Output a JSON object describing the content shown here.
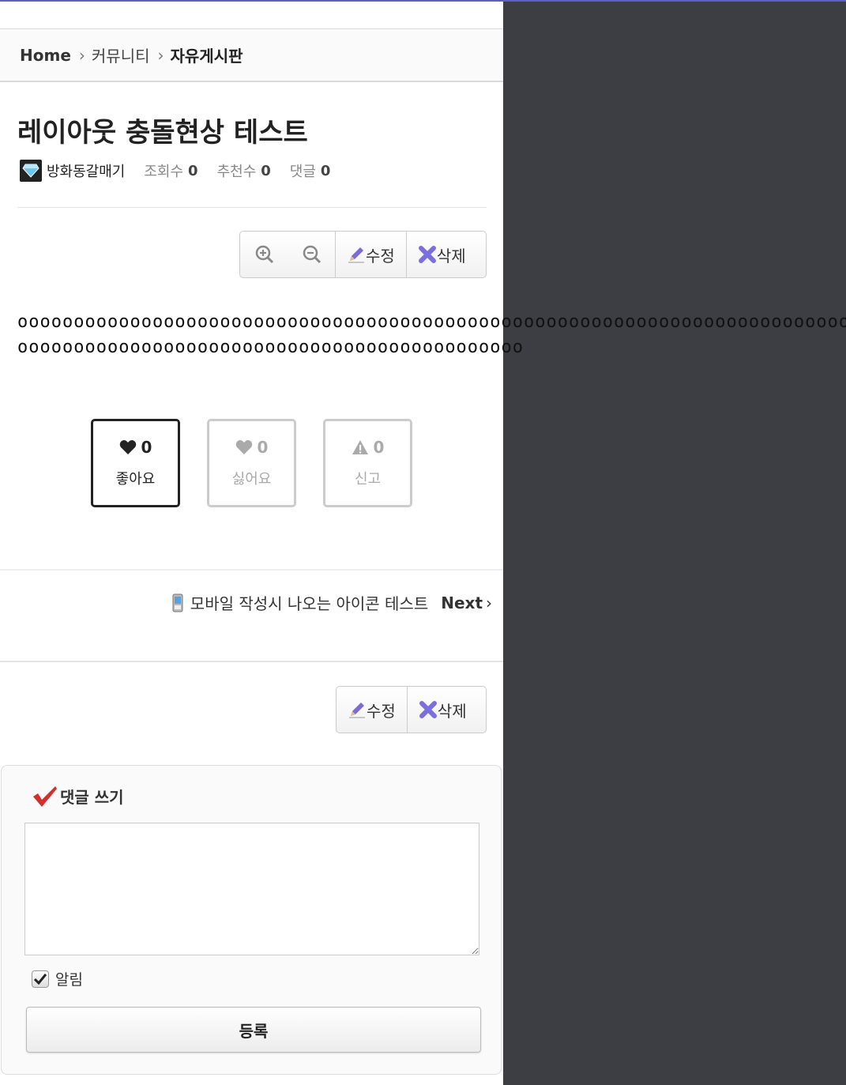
{
  "breadcrumb": {
    "home": "Home",
    "level1": "커뮤니티",
    "level2": "자유게시판"
  },
  "post": {
    "title": "레이아웃 충돌현상 테스트",
    "author": "방화동갈매기",
    "views_label": "조회수",
    "views": "0",
    "recommend_label": "추천수",
    "recommend": "0",
    "comments_label": "댓글",
    "comments": "0",
    "body_line1": "ooooooooooooooooooooooooooooooooooooooooooooooooooooooooooooooooooooooooooooooooooooooo",
    "body_line2": "ooooooooooooooooooooooooooooooooooooooooooooo"
  },
  "toolbar": {
    "edit_label": "수정",
    "delete_label": "삭제"
  },
  "votes": {
    "like": {
      "count": "0",
      "label": "좋아요"
    },
    "dislike": {
      "count": "0",
      "label": "싫어요"
    },
    "report": {
      "count": "0",
      "label": "신고"
    }
  },
  "navigation": {
    "next_title": "모바일 작성시 나오는 아이콘 테스트",
    "next_label": "Next"
  },
  "comment_form": {
    "title": "댓글 쓰기",
    "notify_label": "알림",
    "submit_label": "등록",
    "textarea_value": ""
  },
  "colors": {
    "accent": "#5b5fc7",
    "check_red": "#d32f2f",
    "sidebar": "#3d3e44"
  },
  "icons": [
    "zoom-in-icon",
    "zoom-out-icon",
    "pencil-icon",
    "delete-x-icon",
    "heart-icon",
    "warning-icon",
    "phone-icon",
    "checkmark-icon",
    "chevron-right-icon",
    "diamond-icon"
  ]
}
